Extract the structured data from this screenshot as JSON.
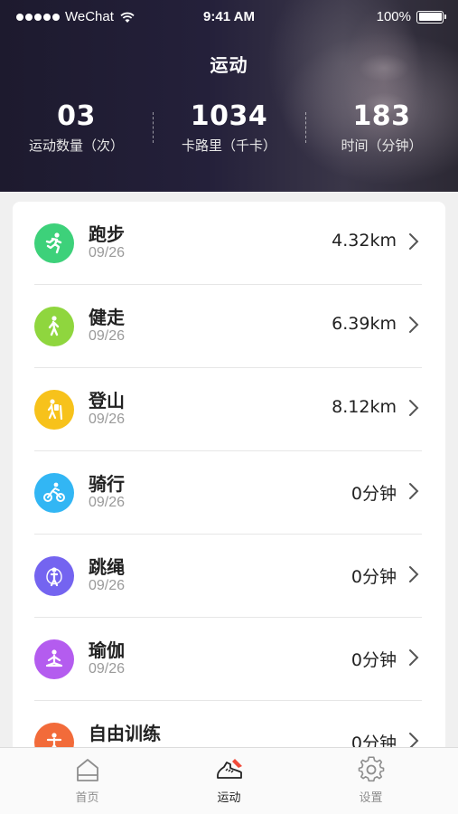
{
  "status_bar": {
    "carrier": "WeChat",
    "time": "9:41 AM",
    "battery": "100%"
  },
  "header": {
    "title": "运动",
    "stats": [
      {
        "value": "03",
        "label": "运动数量（次）"
      },
      {
        "value": "1034",
        "label": "卡路里（千卡）"
      },
      {
        "value": "183",
        "label": "时间（分钟）"
      }
    ]
  },
  "activities": [
    {
      "name": "跑步",
      "date": "09/26",
      "value": "4.32km",
      "icon": "running-icon",
      "color": "#3dd17a"
    },
    {
      "name": "健走",
      "date": "09/26",
      "value": "6.39km",
      "icon": "walking-icon",
      "color": "#8fd63e"
    },
    {
      "name": "登山",
      "date": "09/26",
      "value": "8.12km",
      "icon": "hiking-icon",
      "color": "#f7c21b"
    },
    {
      "name": "骑行",
      "date": "09/26",
      "value": "0分钟",
      "icon": "cycling-icon",
      "color": "#32b6f4"
    },
    {
      "name": "跳绳",
      "date": "09/26",
      "value": "0分钟",
      "icon": "jump-rope-icon",
      "color": "#7464f0"
    },
    {
      "name": "瑜伽",
      "date": "09/26",
      "value": "0分钟",
      "icon": "yoga-icon",
      "color": "#b45cef"
    },
    {
      "name": "自由训练",
      "date": "",
      "value": "0分钟",
      "icon": "free-training-icon",
      "color": "#f26b3a"
    }
  ],
  "tabbar": {
    "tabs": [
      {
        "label": "首页",
        "icon": "home-icon",
        "active": false
      },
      {
        "label": "运动",
        "icon": "sneaker-icon",
        "active": true
      },
      {
        "label": "设置",
        "icon": "gear-icon",
        "active": false
      }
    ]
  }
}
